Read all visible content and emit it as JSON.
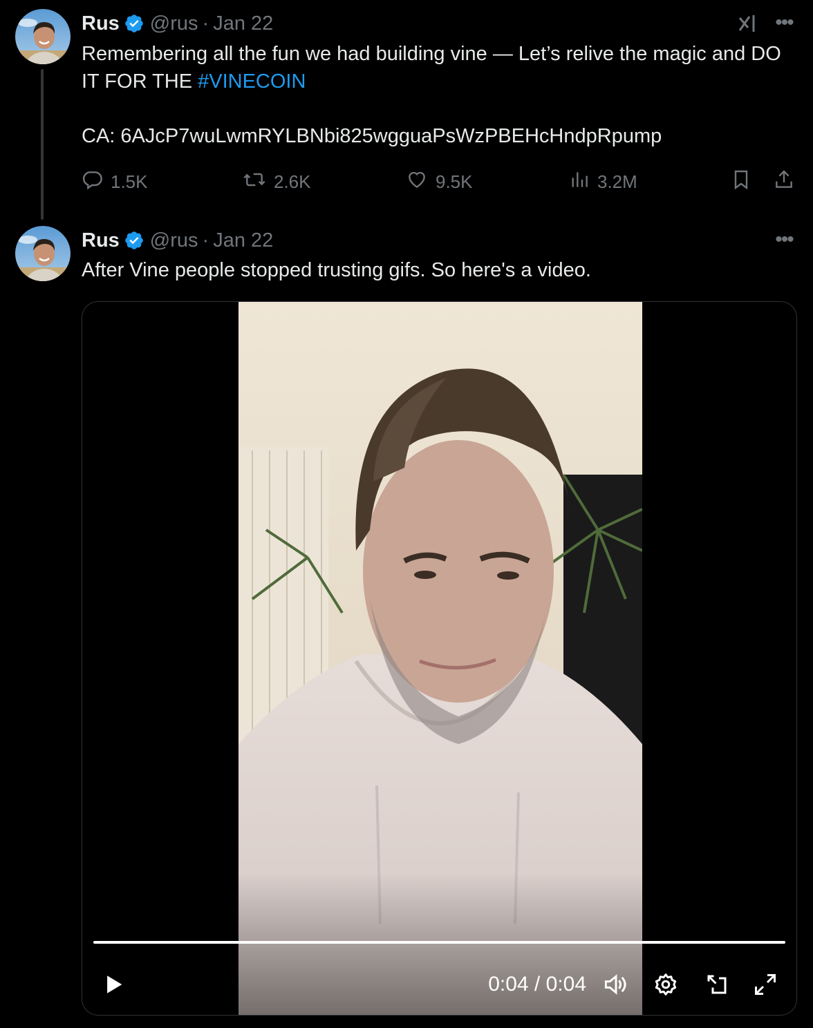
{
  "colors": {
    "background": "#000000",
    "text": "#e7e9ea",
    "muted": "#71767b",
    "accent": "#1d9bf0",
    "verified": "#1d9bf0"
  },
  "tweet1": {
    "name": "Rus",
    "handle": "@rus",
    "separator": "·",
    "date": "Jan 22",
    "text_before_hashtag": "Remembering all the fun we had building vine — Let’s relive the magic and DO IT FOR THE ",
    "hashtag": "#VINECOIN",
    "ca_line": "CA: 6AJcP7wuLwmRYLBNbi825wgguaPsWzPBEHcHndpRpump",
    "stats": {
      "replies": "1.5K",
      "reposts": "2.6K",
      "likes": "9.5K",
      "views": "3.2M"
    },
    "icons": [
      "verified-badge-icon",
      "grok-icon",
      "more-icon",
      "reply-icon",
      "repost-icon",
      "like-icon",
      "views-icon",
      "bookmark-icon",
      "share-icon"
    ]
  },
  "tweet2": {
    "name": "Rus",
    "handle": "@rus",
    "separator": "·",
    "date": "Jan 22",
    "text": "After Vine people stopped trusting gifs. So here's a video.",
    "video": {
      "current_time": "0:04",
      "time_separator": "/",
      "duration": "0:04",
      "time_display": "0:04 / 0:04",
      "progress_fraction": 1.0,
      "icons": [
        "play-icon",
        "volume-icon",
        "settings-icon",
        "pop-out-icon",
        "fullscreen-icon"
      ]
    }
  }
}
